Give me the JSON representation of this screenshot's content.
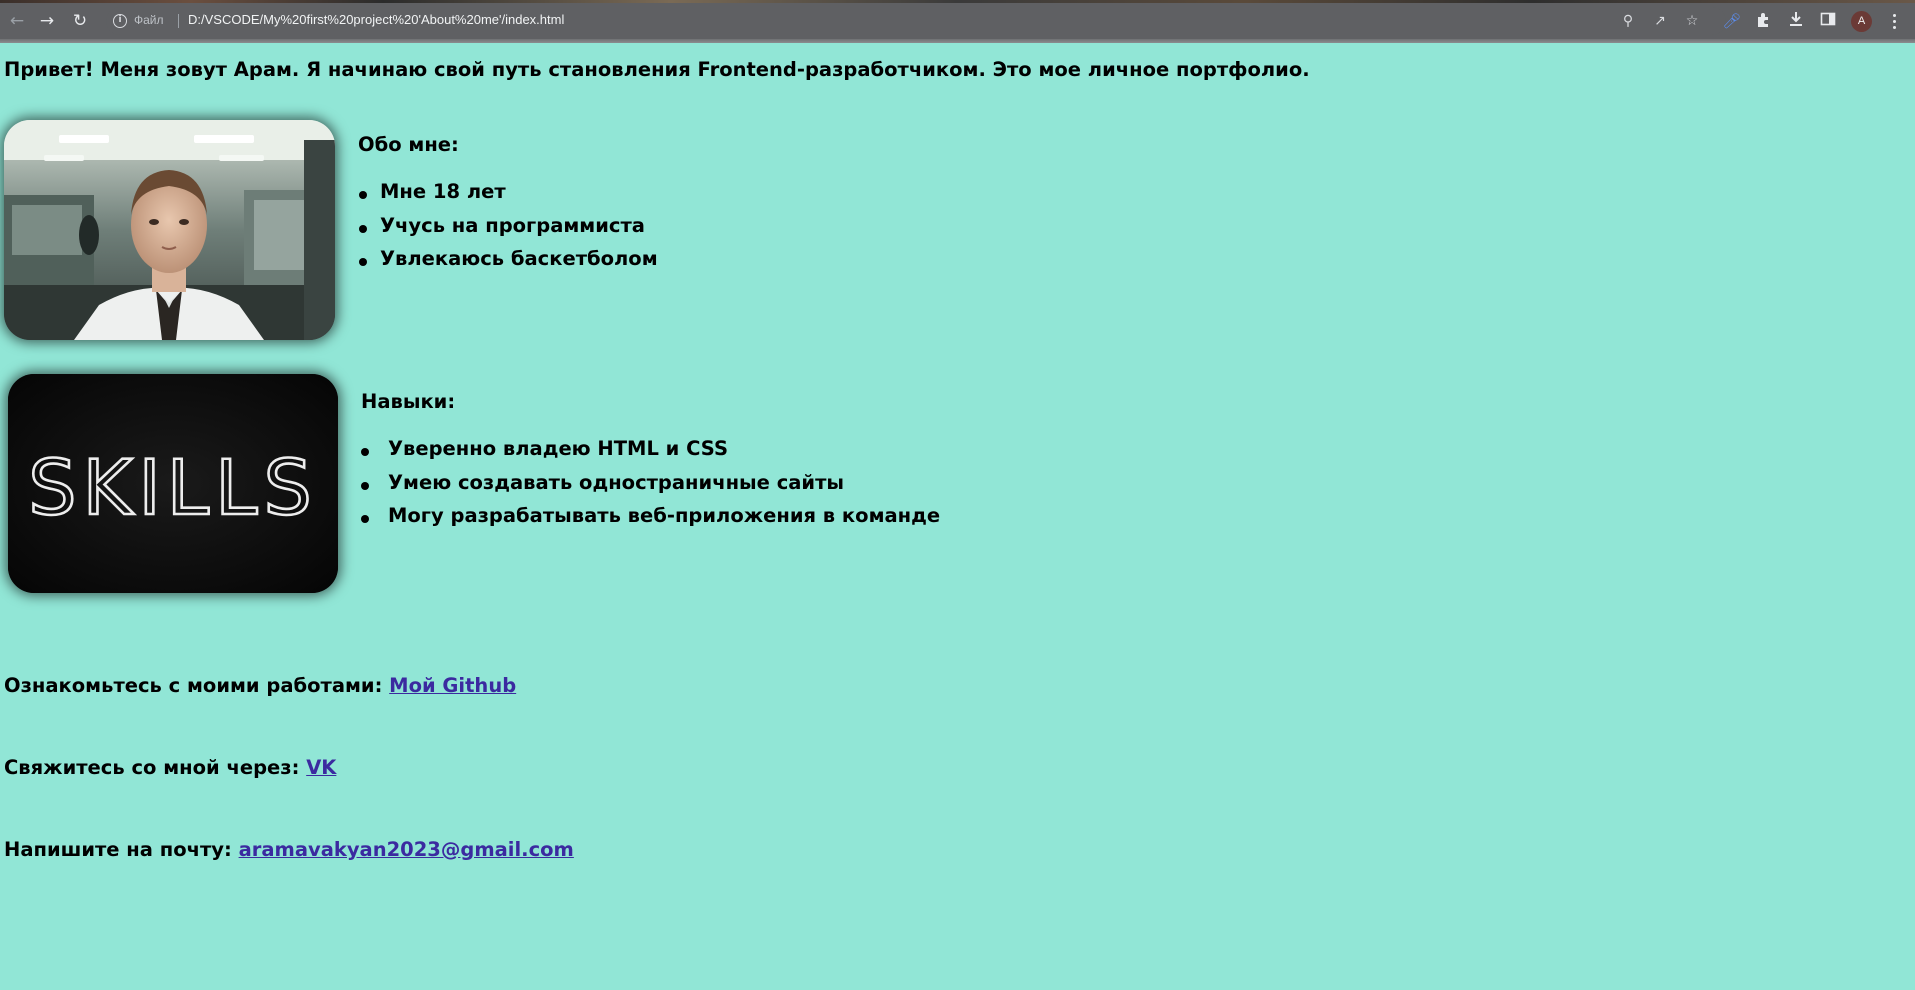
{
  "browser": {
    "scheme_label": "Файл",
    "url": "D:/VSCODE/My%20first%20project%20'About%20me'/index.html",
    "profile_initial": "A",
    "accent_color": "#5b8def"
  },
  "page": {
    "background_color": "#91e6d6",
    "link_color": "#3b2aa0",
    "intro": "Привет! Меня зовут Арам. Я начинаю свой путь становления Frontend-разработчиком. Это мое личное портфолио.",
    "about": {
      "title": "Обо мне:",
      "items": [
        "Мне 18 лет",
        "Учусь на программиста",
        "Увлекаюсь баскетболом"
      ]
    },
    "skills": {
      "title": "Навыки:",
      "image_text": "SKILLS",
      "items": [
        "Уверенно владею HTML и CSS",
        "Умею создавать одностраничные сайты",
        "Могу разрабатывать веб-приложения в команде"
      ]
    },
    "works": {
      "label": "Ознакомьтесь с моими работами:",
      "link_text": "Мой Github"
    },
    "contact": {
      "label": "Свяжитесь со мной через:",
      "link_text": "VK"
    },
    "mail": {
      "label": "Напишите на почту:",
      "link_text": "aramavakyan2023@gmail.com"
    }
  }
}
